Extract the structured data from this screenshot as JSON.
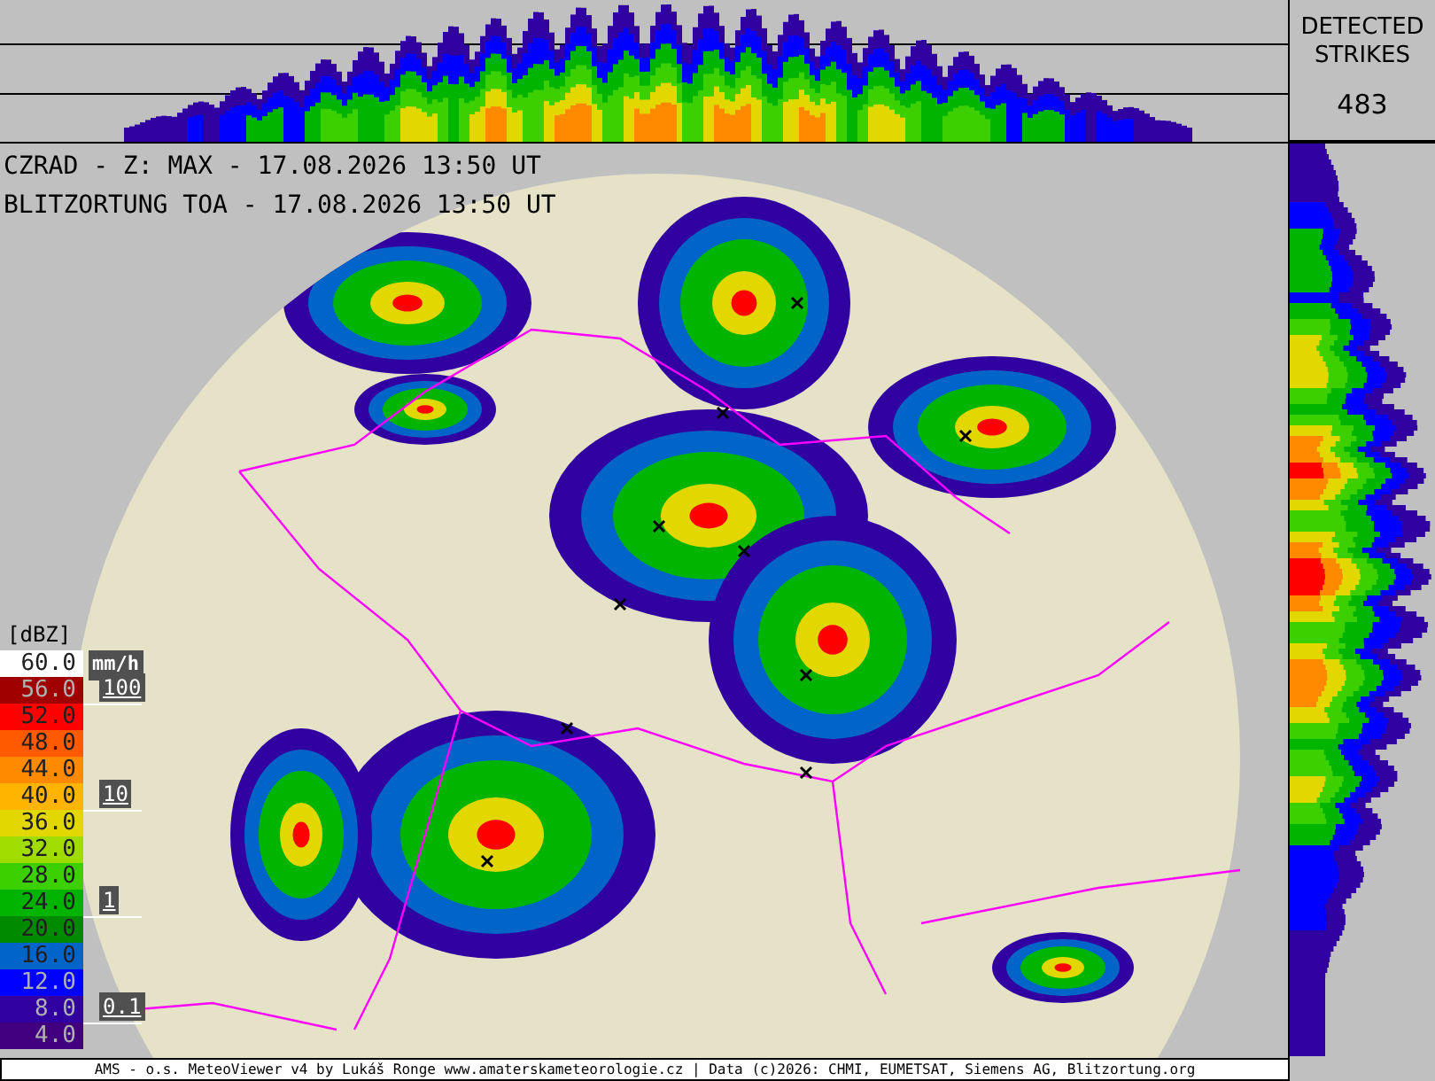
{
  "header": {
    "radar_line": "CZRAD - Z: MAX - 17.08.2026 13:50 UT",
    "lightning_line": "BLITZORTUNG TOA - 17.08.2026 13:50 UT"
  },
  "strikes": {
    "label_1": "DETECTED",
    "label_2": "STRIKES",
    "count": "483"
  },
  "legend": {
    "unit": "[dBZ]",
    "rate_unit": "mm/h",
    "items": [
      {
        "label": "60.0",
        "color": "#ffffff"
      },
      {
        "label": "56.0",
        "color": "#a00000",
        "rain_rate": "100"
      },
      {
        "label": "52.0",
        "color": "#ff0000"
      },
      {
        "label": "48.0",
        "color": "#ff5a00"
      },
      {
        "label": "44.0",
        "color": "#ff8a00"
      },
      {
        "label": "40.0",
        "color": "#ffb400",
        "rain_rate": "10"
      },
      {
        "label": "36.0",
        "color": "#e2d800"
      },
      {
        "label": "32.0",
        "color": "#a0dc00"
      },
      {
        "label": "28.0",
        "color": "#3cd000"
      },
      {
        "label": "24.0",
        "color": "#00b400",
        "rain_rate": "1"
      },
      {
        "label": "20.0",
        "color": "#008a00"
      },
      {
        "label": "16.0",
        "color": "#0064c8"
      },
      {
        "label": "12.0",
        "color": "#0000ff"
      },
      {
        "label": "8.0",
        "color": "#3000a0",
        "rain_rate": "0.1"
      },
      {
        "label": "4.0",
        "color": "#400080"
      }
    ]
  },
  "footer": "AMS - o.s. MeteoViewer v4 by Lukáš Ronge www.amaterskameteorologie.cz | Data (c)2026: CHMI, EUMETSAT, Siemens AG, Blitzortung.org"
}
